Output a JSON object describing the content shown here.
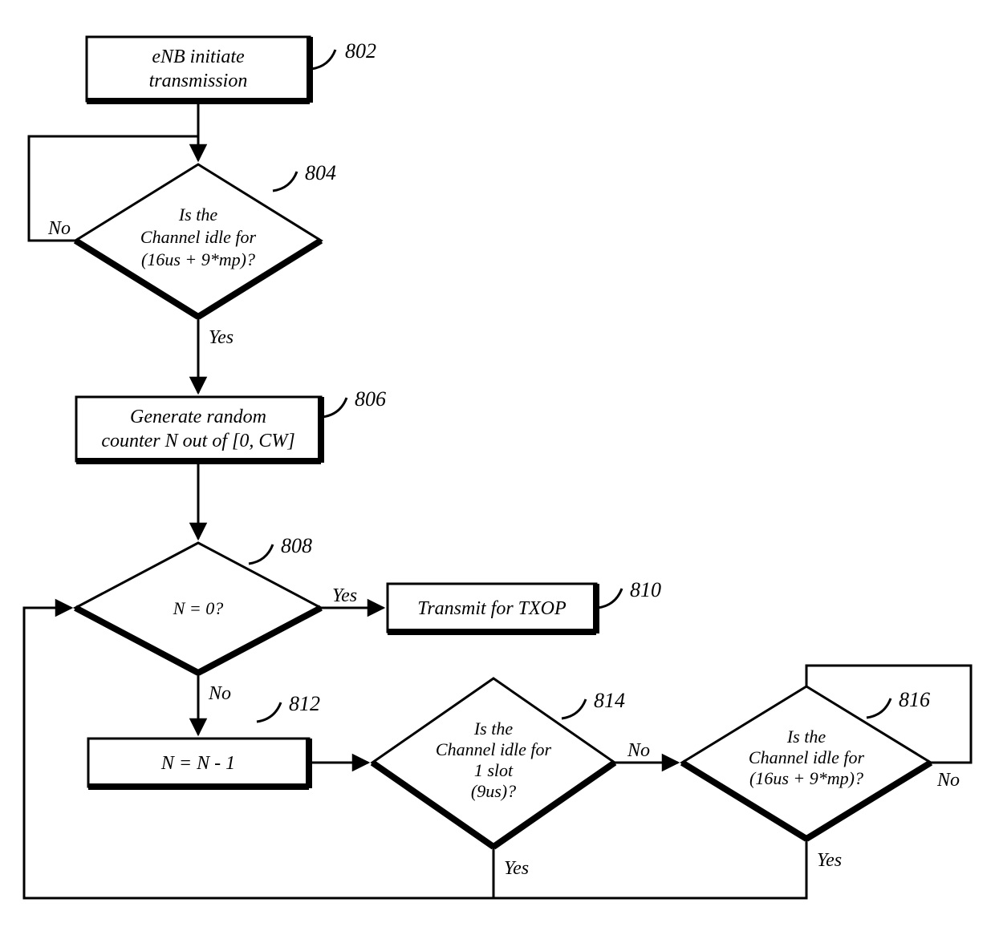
{
  "nodes": {
    "n802": {
      "label": "802",
      "line1": "eNB initiate",
      "line2": "transmission"
    },
    "n804": {
      "label": "804",
      "line1": "Is the",
      "line2": "Channel idle for",
      "line3": "(16us + 9*mp)?"
    },
    "n806": {
      "label": "806",
      "line1": "Generate random",
      "line2": "counter N out of [0, CW]"
    },
    "n808": {
      "label": "808",
      "line1": "N = 0?"
    },
    "n810": {
      "label": "810",
      "line1": "Transmit for TXOP"
    },
    "n812": {
      "label": "812",
      "line1": "N = N - 1"
    },
    "n814": {
      "label": "814",
      "line1": "Is the",
      "line2": "Channel idle for",
      "line3": "1 slot",
      "line4": "(9us)?"
    },
    "n816": {
      "label": "816",
      "line1": "Is the",
      "line2": "Channel idle for",
      "line3": "(16us + 9*mp)?"
    }
  },
  "labels": {
    "yes": "Yes",
    "no": "No"
  }
}
